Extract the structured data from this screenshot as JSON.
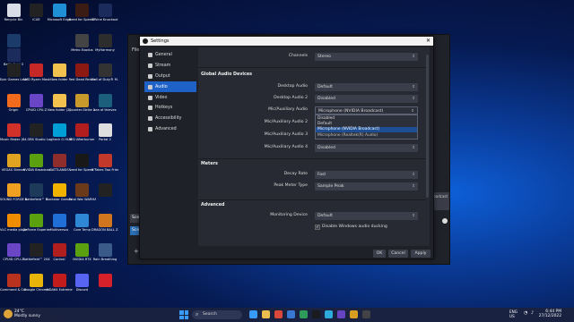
{
  "desktop_icons": [
    {
      "label": "Recycle Bin",
      "color": "#d8dde6",
      "x": 0,
      "y": 0
    },
    {
      "label": "iCUE",
      "color": "#222222",
      "x": 1,
      "y": 0
    },
    {
      "label": "Microsoft Edge",
      "color": "#1f8fd6",
      "x": 2,
      "y": 0
    },
    {
      "label": "Need for Speed™ Heat",
      "color": "#3b1c14",
      "x": 3,
      "y": 0
    },
    {
      "label": "Divine Knockout",
      "color": "#1b2b5c",
      "x": 4,
      "y": 0
    },
    {
      "label": "Steam",
      "color": "#1b3b6a",
      "x": 0,
      "y": 1
    },
    {
      "label": "Metro Exodus",
      "color": "#444444",
      "x": 3,
      "y": 1
    },
    {
      "label": "MyHarmony",
      "color": "#2d2d2d",
      "x": 4,
      "y": 1
    },
    {
      "label": "Battlefield 3",
      "color": "#1b2b5c",
      "x": 0,
      "y": 1.5
    },
    {
      "label": "Epic Games Launcher",
      "color": "#222222",
      "x": 0,
      "y": 2
    },
    {
      "label": "AMD Ryzen Master",
      "color": "#c62828",
      "x": 1,
      "y": 2
    },
    {
      "label": "New folder",
      "color": "#f2c14e",
      "x": 2,
      "y": 2
    },
    {
      "label": "Red Dead Redemption",
      "color": "#8c1a12",
      "x": 3,
      "y": 2
    },
    {
      "label": "Call of Duty® M...",
      "color": "#333333",
      "x": 4,
      "y": 2
    },
    {
      "label": "Origin",
      "color": "#f26a1b",
      "x": 0,
      "y": 3
    },
    {
      "label": "CPUID CPU-Z",
      "color": "#6a46c6",
      "x": 1,
      "y": 3
    },
    {
      "label": "New folder (2)",
      "color": "#f2c14e",
      "x": 2,
      "y": 3
    },
    {
      "label": "Counter-Strike 2",
      "color": "#c89a2c",
      "x": 3,
      "y": 3
    },
    {
      "label": "sea of thieves",
      "color": "#1c5f7d",
      "x": 4,
      "y": 3
    },
    {
      "label": "Music Maker (64-Bit)",
      "color": "#d2312a",
      "x": 0,
      "y": 4
    },
    {
      "label": "OBS Studio",
      "color": "#222222",
      "x": 1,
      "y": 4
    },
    {
      "label": "Logitech G HUB",
      "color": "#00a0d6",
      "x": 2,
      "y": 4
    },
    {
      "label": "MSI Afterburner",
      "color": "#b21d1d",
      "x": 3,
      "y": 4
    },
    {
      "label": "Portal 2",
      "color": "#dedede",
      "x": 4,
      "y": 4
    },
    {
      "label": "VEGAS Stream",
      "color": "#e0a321",
      "x": 0,
      "y": 5
    },
    {
      "label": "NVIDIA Broadcast",
      "color": "#5aa00f",
      "x": 1,
      "y": 5
    },
    {
      "label": "BATTLANDS",
      "color": "#8f2c2c",
      "x": 2,
      "y": 5
    },
    {
      "label": "Need for Speed™",
      "color": "#181818",
      "x": 3,
      "y": 5
    },
    {
      "label": "It Takes Two Friend's Pass",
      "color": "#c0392b",
      "x": 4,
      "y": 5
    },
    {
      "label": "SOUND FORGE Audi...",
      "color": "#f0a020",
      "x": 0,
      "y": 6
    },
    {
      "label": "Battlefield™ V",
      "color": "#1e3a5a",
      "x": 1,
      "y": 6
    },
    {
      "label": "Rockstar Games ...",
      "color": "#f2b200",
      "x": 2,
      "y": 6
    },
    {
      "label": "Total War WARHAM...",
      "color": "#6a3a1a",
      "x": 3,
      "y": 6
    },
    {
      "label": "",
      "color": "#222222",
      "x": 4,
      "y": 6
    },
    {
      "label": "VLC media player",
      "color": "#f08c00",
      "x": 0,
      "y": 7
    },
    {
      "label": "GeForce Experience",
      "color": "#5aa00f",
      "x": 1,
      "y": 7
    },
    {
      "label": "Multiversus",
      "color": "#1f6fd6",
      "x": 2,
      "y": 7
    },
    {
      "label": "Core Temp",
      "color": "#2f88d6",
      "x": 3,
      "y": 7
    },
    {
      "label": "DRAGON BALL Z...",
      "color": "#d0761e",
      "x": 4,
      "y": 7
    },
    {
      "label": "CPUID CPU-Z",
      "color": "#6a46c6",
      "x": 0,
      "y": 8
    },
    {
      "label": "Battlefield™ 2042",
      "color": "#222222",
      "x": 1,
      "y": 8
    },
    {
      "label": "Control",
      "color": "#b01e1e",
      "x": 2,
      "y": 8
    },
    {
      "label": "NVIDIA RTX",
      "color": "#5aa00f",
      "x": 3,
      "y": 8
    },
    {
      "label": "Rain Breathing",
      "color": "#3a5b8a",
      "x": 4,
      "y": 8
    },
    {
      "label": "Command & Conquer™",
      "color": "#b8321e",
      "x": 0,
      "y": 9
    },
    {
      "label": "Google Chrome",
      "color": "#e8b40a",
      "x": 1,
      "y": 9
    },
    {
      "label": "AIDA64 Extreme",
      "color": "#c21c1c",
      "x": 2,
      "y": 9
    },
    {
      "label": "Discord",
      "color": "#5865f2",
      "x": 3,
      "y": 9
    },
    {
      "label": "",
      "color": "#d6212a",
      "x": 4,
      "y": 9
    }
  ],
  "obs_window": {
    "menu": "File",
    "scenes_label": "Sce",
    "scene_item": "Sce",
    "right_pane": "Broadcast"
  },
  "dialog": {
    "title": "Settings",
    "close": "✕",
    "sidebar": [
      {
        "label": "General",
        "active": false
      },
      {
        "label": "Stream",
        "active": false
      },
      {
        "label": "Output",
        "active": false
      },
      {
        "label": "Audio",
        "active": true
      },
      {
        "label": "Video",
        "active": false
      },
      {
        "label": "Hotkeys",
        "active": false
      },
      {
        "label": "Accessibility",
        "active": false
      },
      {
        "label": "Advanced",
        "active": false
      }
    ],
    "channels_label": "Channels",
    "channels_value": "Stereo",
    "global_header": "Global Audio Devices",
    "devices": [
      {
        "label": "Desktop Audio",
        "value": "Default"
      },
      {
        "label": "Desktop Audio 2",
        "value": "Disabled"
      },
      {
        "label": "Mic/Auxiliary Audio",
        "value": "Microphone (NVIDIA Broadcast)"
      },
      {
        "label": "Mic/Auxiliary Audio 2",
        "value": ""
      },
      {
        "label": "Mic/Auxiliary Audio 3",
        "value": ""
      },
      {
        "label": "Mic/Auxiliary Audio 4",
        "value": "Disabled"
      }
    ],
    "dropdown_options": [
      {
        "label": "Disabled"
      },
      {
        "label": "Default"
      },
      {
        "label": "Microphone (NVIDIA Broadcast)"
      },
      {
        "label": "Microphone (Realtek(R) Audio)"
      }
    ],
    "meters_header": "Meters",
    "decay_label": "Decay Rate",
    "decay_value": "Fast",
    "peak_label": "Peak Meter Type",
    "peak_value": "Sample Peak",
    "advanced_header": "Advanced",
    "monitoring_label": "Monitoring Device",
    "monitoring_value": "Default",
    "ducking_label": "Disable Windows audio ducking",
    "ducking_checked": true,
    "buttons": {
      "ok": "OK",
      "cancel": "Cancel",
      "apply": "Apply"
    }
  },
  "taskbar": {
    "temp": "24°C",
    "weather": "Mostly sunny",
    "search": "Search",
    "tray_lang": "ENG\nUS",
    "time": "6:44 PM",
    "date": "27/12/2022",
    "apps": [
      "#3aa0ff",
      "#f2c14e",
      "#e04a3a",
      "#3b7bd6",
      "#2fa05a",
      "#1b1b1b",
      "#2fb0e0",
      "#6a46c6",
      "#e0a321",
      "#444444"
    ]
  },
  "colors": {
    "accent": "#1e62c8",
    "dialog_bg": "#1f2128",
    "content_bg": "#272a33"
  }
}
